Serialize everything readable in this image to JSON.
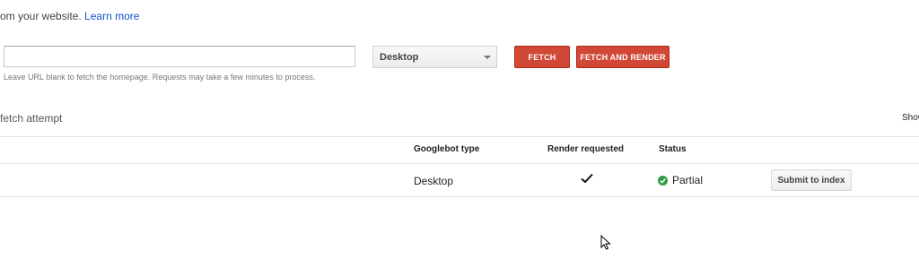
{
  "intro": {
    "text": "om your website.",
    "link": "Learn more"
  },
  "form": {
    "url_value": "",
    "url_placeholder": "",
    "hint": "Leave URL blank to fetch the homepage. Requests may take a few minutes to process.",
    "device_selected": "Desktop",
    "fetch_label": "FETCH",
    "fetch_render_label": "FETCH AND RENDER"
  },
  "history": {
    "title": "fetch attempt",
    "show_label": "Show",
    "columns": {
      "googlebot_type": "Googlebot type",
      "render_requested": "Render requested",
      "status": "Status"
    },
    "rows": [
      {
        "googlebot_type": "Desktop",
        "render_requested": true,
        "status": "Partial",
        "status_icon": "check-circle-icon",
        "action_label": "Submit to index"
      }
    ]
  },
  "colors": {
    "accent_red": "#d14836",
    "link_blue": "#1155cc",
    "status_green": "#2e9e44"
  }
}
